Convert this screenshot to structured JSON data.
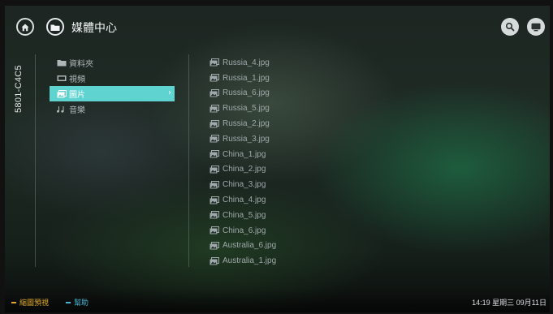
{
  "header": {
    "title": "媒體中心",
    "icons": [
      "home-icon",
      "folder-icon",
      "search-icon",
      "tv-icon"
    ]
  },
  "sidebar": {
    "device_label": "5801-C4C5"
  },
  "menu": {
    "items": [
      {
        "label": "資料夾",
        "icon": "folder-icon",
        "selected": false
      },
      {
        "label": "視頻",
        "icon": "video-icon",
        "selected": false
      },
      {
        "label": "圖片",
        "icon": "picture-icon",
        "selected": true
      },
      {
        "label": "音樂",
        "icon": "music-icon",
        "selected": false
      }
    ],
    "selected_color": "#5fd3cf"
  },
  "files": [
    "Russia_4.jpg",
    "Russia_1.jpg",
    "Russia_6.jpg",
    "Russia_5.jpg",
    "Russia_2.jpg",
    "Russia_3.jpg",
    "China_1.jpg",
    "China_2.jpg",
    "China_3.jpg",
    "China_4.jpg",
    "China_5.jpg",
    "China_6.jpg",
    "Australia_6.jpg",
    "Australia_1.jpg"
  ],
  "footer": {
    "hints": [
      {
        "label": "縮圖預視",
        "color": "#e0a72b"
      },
      {
        "label": "幫助",
        "color": "#45b8d9"
      }
    ],
    "clock": "14:19 星期三 09月11日"
  }
}
